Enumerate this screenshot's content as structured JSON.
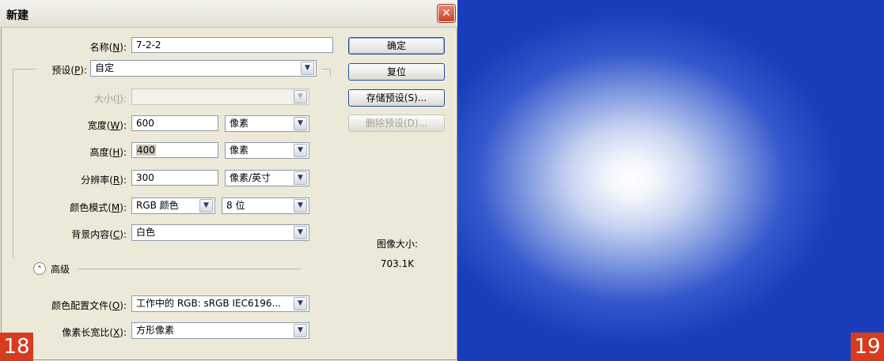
{
  "dialog": {
    "title": "新建",
    "close_glyph": "✕",
    "name": {
      "label": "名称(",
      "key": "N",
      "tail": "):",
      "value": "7-2-2"
    },
    "preset": {
      "label": "预设(",
      "key": "P",
      "tail": "):",
      "value": "自定"
    },
    "size": {
      "label": "大小(",
      "key": "I",
      "tail": "):",
      "value": ""
    },
    "width": {
      "label": "宽度(",
      "key": "W",
      "tail": "):",
      "value": "600",
      "unit": "像素"
    },
    "height": {
      "label": "高度(",
      "key": "H",
      "tail": "):",
      "value": "400",
      "unit": "像素"
    },
    "resolution": {
      "label": "分辨率(",
      "key": "R",
      "tail": "):",
      "value": "300",
      "unit": "像素/英寸"
    },
    "color_mode": {
      "label": "颜色模式(",
      "key": "M",
      "tail": "):",
      "value": "RGB 颜色",
      "depth": "8 位"
    },
    "background": {
      "label": "背景内容(",
      "key": "C",
      "tail": "):",
      "value": "白色"
    },
    "advanced": {
      "label": "高级"
    },
    "color_profile": {
      "label": "颜色配置文件(",
      "key": "O",
      "tail": "):",
      "value": "工作中的 RGB: sRGB IEC6196..."
    },
    "pixel_aspect": {
      "label": "像素长宽比(",
      "key": "X",
      "tail": "):",
      "value": "方形像素"
    },
    "buttons": {
      "ok": "确定",
      "reset": "复位",
      "save_preset": "存储预设(S)...",
      "delete_preset": "删除预设(D)..."
    },
    "image_size": {
      "label": "图像大小:",
      "value": "703.1K"
    }
  },
  "badges": {
    "left": "18",
    "right": "19"
  },
  "icons": {
    "close": "close-icon",
    "dropdown": "chevron-down-icon",
    "collapse": "double-chevron-up-icon"
  }
}
